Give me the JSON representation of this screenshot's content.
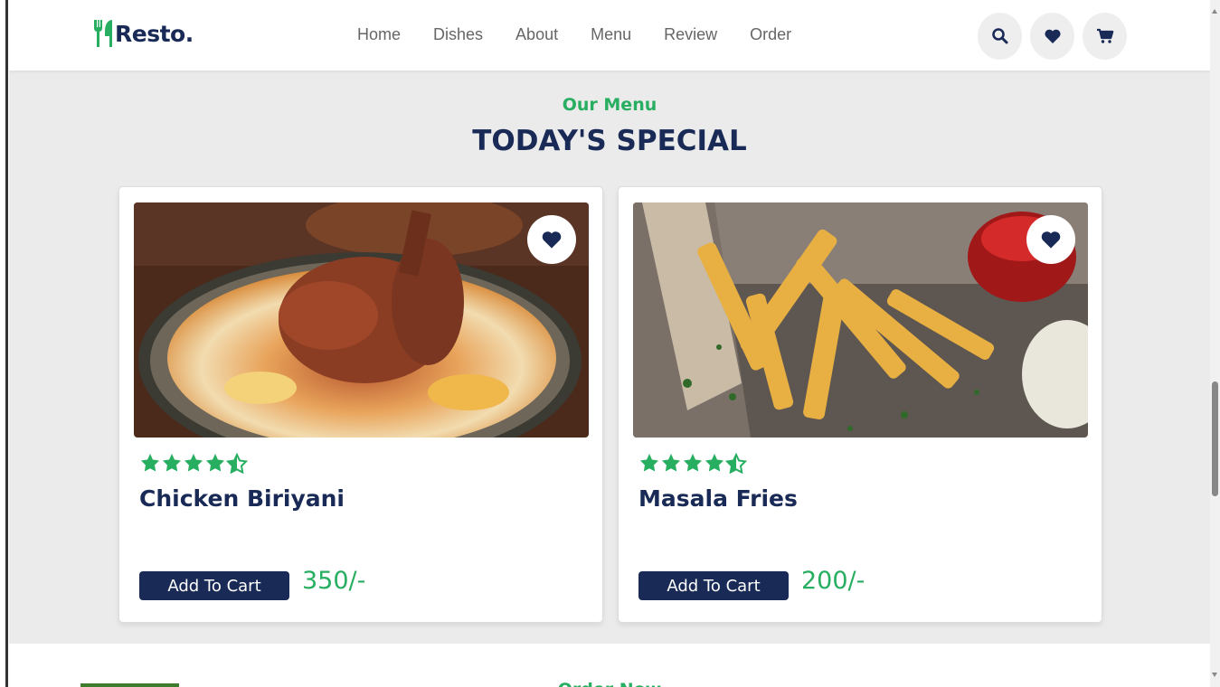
{
  "header": {
    "logo_icon": "utensils-icon",
    "logo_text": "Resto.",
    "nav": [
      "Home",
      "Dishes",
      "About",
      "Menu",
      "Review",
      "Order"
    ],
    "icons": [
      "search-icon",
      "heart-icon",
      "cart-icon"
    ]
  },
  "section": {
    "subtitle": "Our Menu",
    "title": "TODAY'S SPECIAL"
  },
  "cards": [
    {
      "name": "Chicken Biriyani",
      "rating": 4.5,
      "button": "Add To Cart",
      "price": "350/-"
    },
    {
      "name": "Masala Fries",
      "rating": 4.5,
      "button": "Add To Cart",
      "price": "200/-"
    }
  ],
  "next_section": {
    "title": "Order Now"
  },
  "colors": {
    "accent": "#27ae60",
    "primary": "#192a56",
    "background": "#ebebeb"
  }
}
